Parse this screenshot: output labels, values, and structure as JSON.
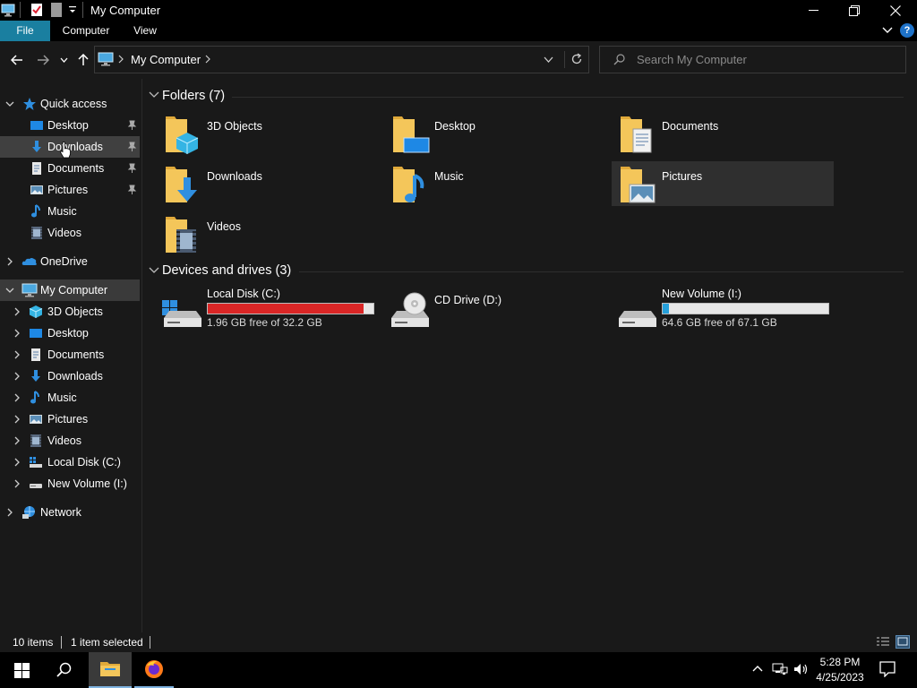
{
  "window": {
    "title": "My Computer",
    "minimize": "minimize",
    "maximize": "restore",
    "close": "close"
  },
  "ribbon": {
    "tabs": [
      "File",
      "Computer",
      "View"
    ],
    "help": "?"
  },
  "address": {
    "path": "My Computer",
    "search_placeholder": "Search My Computer"
  },
  "sidebar": {
    "quick_access": "Quick access",
    "quick_items": [
      {
        "label": "Desktop",
        "icon": "desktop-icon",
        "pinned": true
      },
      {
        "label": "Downloads",
        "icon": "downloads-icon",
        "pinned": true
      },
      {
        "label": "Documents",
        "icon": "documents-icon",
        "pinned": true
      },
      {
        "label": "Pictures",
        "icon": "pictures-icon",
        "pinned": true
      },
      {
        "label": "Music",
        "icon": "music-icon",
        "pinned": false
      },
      {
        "label": "Videos",
        "icon": "videos-icon",
        "pinned": false
      }
    ],
    "onedrive": "OneDrive",
    "my_computer": "My Computer",
    "computer_items": [
      {
        "label": "3D Objects",
        "icon": "3d-objects-icon"
      },
      {
        "label": "Desktop",
        "icon": "desktop-icon"
      },
      {
        "label": "Documents",
        "icon": "documents-icon"
      },
      {
        "label": "Downloads",
        "icon": "downloads-icon"
      },
      {
        "label": "Music",
        "icon": "music-icon"
      },
      {
        "label": "Pictures",
        "icon": "pictures-icon"
      },
      {
        "label": "Videos",
        "icon": "videos-icon"
      },
      {
        "label": "Local Disk (C:)",
        "icon": "local-disk-icon"
      },
      {
        "label": "New Volume (I:)",
        "icon": "drive-icon"
      }
    ],
    "network": "Network"
  },
  "folders": {
    "heading": "Folders (7)",
    "items": [
      {
        "label": "3D Objects",
        "icon": "3d-objects-folder-icon"
      },
      {
        "label": "Desktop",
        "icon": "desktop-folder-icon"
      },
      {
        "label": "Documents",
        "icon": "documents-folder-icon"
      },
      {
        "label": "Downloads",
        "icon": "downloads-folder-icon"
      },
      {
        "label": "Music",
        "icon": "music-folder-icon"
      },
      {
        "label": "Pictures",
        "icon": "pictures-folder-icon",
        "selected": true
      },
      {
        "label": "Videos",
        "icon": "videos-folder-icon"
      }
    ]
  },
  "drives": {
    "heading": "Devices and drives (3)",
    "items": [
      {
        "label": "Local Disk (C:)",
        "free": "1.96 GB free of 32.2 GB",
        "used_fraction": 0.939,
        "bar_color": "#da2626",
        "icon": "local-disk-icon"
      },
      {
        "label": "CD Drive (D:)",
        "icon": "cd-drive-icon"
      },
      {
        "label": "New Volume (I:)",
        "free": "64.6 GB free of 67.1 GB",
        "used_fraction": 0.037,
        "bar_color": "#26a0da",
        "icon": "drive-icon"
      }
    ]
  },
  "status": {
    "items_count": "10 items",
    "selected": "1 item selected"
  },
  "taskbar": {
    "time": "5:28 PM",
    "date": "4/25/2023"
  },
  "colors": {
    "accent": "#1a7fa0",
    "folder": "#f4c65a",
    "disk_full": "#da2626",
    "disk_ok": "#26a0da"
  }
}
